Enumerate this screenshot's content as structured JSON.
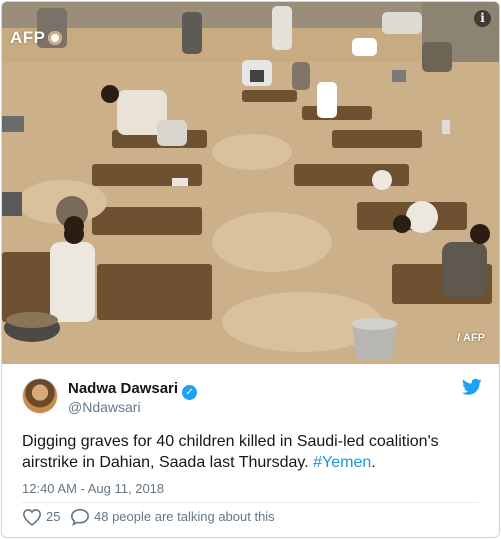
{
  "photo": {
    "agency_logo": "AFP",
    "credit": "/ AFP",
    "info_icon": "info-icon"
  },
  "author": {
    "display_name": "Nadwa Dawsari",
    "handle": "@Ndawsari",
    "verified_icon": "verified-check-icon",
    "platform_icon": "twitter-bird-icon"
  },
  "tweet": {
    "text_line1": "Digging graves for 40 children killed in Saudi-led coalition's",
    "text_line2_prefix": "airstrike in Dahian, Saada last Thursday. ",
    "hashtag": "#Yemen",
    "text_suffix": ".",
    "timestamp": "12:40 AM - Aug 11, 2018"
  },
  "actions": {
    "likes": "25",
    "conversation": "48 people are talking about this"
  },
  "colors": {
    "accent": "#1da1f2",
    "hashtag": "#1b95e0",
    "muted": "#657786",
    "text": "#14171a"
  }
}
